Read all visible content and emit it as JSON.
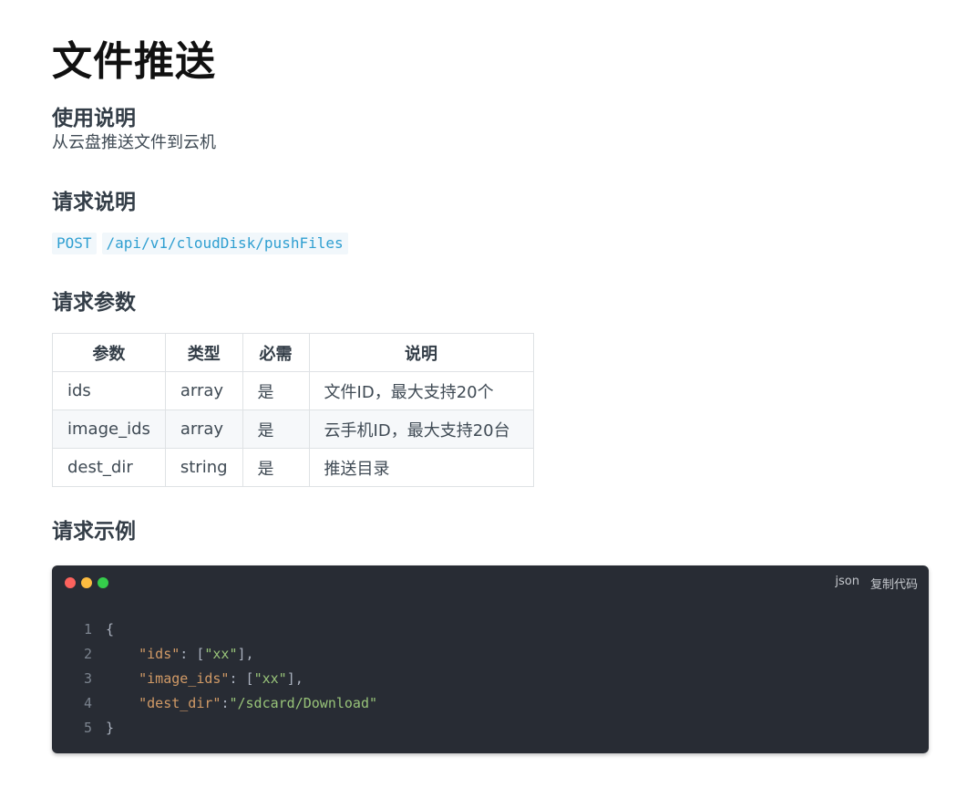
{
  "title": "文件推送",
  "usage": {
    "heading": "使用说明",
    "description": "从云盘推送文件到云机"
  },
  "request": {
    "heading": "请求说明",
    "method": "POST",
    "path": "/api/v1/cloudDisk/pushFiles"
  },
  "params": {
    "heading": "请求参数",
    "headers": [
      "参数",
      "类型",
      "必需",
      "说明"
    ],
    "rows": [
      [
        "ids",
        "array",
        "是",
        "文件ID，最大支持20个"
      ],
      [
        "image_ids",
        "array",
        "是",
        "云手机ID，最大支持20台"
      ],
      [
        "dest_dir",
        "string",
        "是",
        "推送目录"
      ]
    ]
  },
  "example": {
    "heading": "请求示例",
    "lang": "json",
    "copy_label": "复制代码",
    "line_numbers": [
      "1",
      "2",
      "3",
      "4",
      "5"
    ],
    "code": {
      "open": "{",
      "ids_key": "\"ids\"",
      "ids_sep": ": [",
      "ids_val": "\"xx\"",
      "ids_end": "],",
      "image_ids_key": "\"image_ids\"",
      "image_ids_sep": ": [",
      "image_ids_val": "\"xx\"",
      "image_ids_end": "],",
      "dest_dir_key": "\"dest_dir\"",
      "dest_dir_sep": ":",
      "dest_dir_val": "\"/sdcard/Download\"",
      "close": "}"
    }
  },
  "colors": {
    "code_bg": "#282c34",
    "key": "#d19a66",
    "string": "#98c379",
    "dot_red": "#fc625d",
    "dot_yellow": "#fdbc40",
    "dot_green": "#35cd4b"
  }
}
